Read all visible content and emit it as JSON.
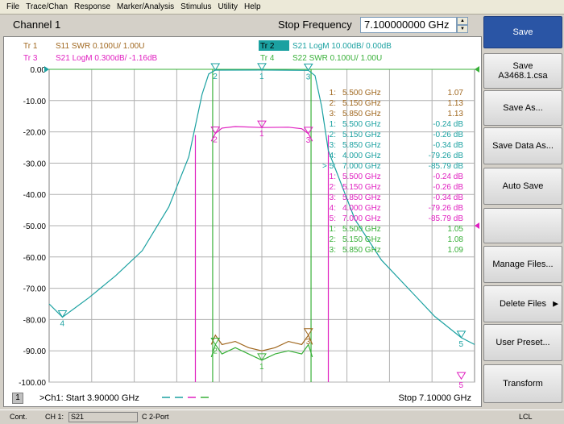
{
  "menu": [
    "File",
    "Trace/Chan",
    "Response",
    "Marker/Analysis",
    "Stimulus",
    "Utility",
    "Help"
  ],
  "header": {
    "channel_title": "Channel 1",
    "stop_label": "Stop Frequency",
    "stop_value": "7.100000000 GHz"
  },
  "traces": [
    {
      "id": "Tr 1",
      "text": "S11 SWR 0.100U/  1.00U",
      "color": "#a0671e",
      "highlight": false
    },
    {
      "id": "Tr 2",
      "text": "S21 LogM 10.00dB/  0.00dB",
      "color": "#1ba1a1",
      "highlight": true
    },
    {
      "id": "Tr 3",
      "text": "S21 LogM 0.300dB/  -1.16dB",
      "color": "#e020c0",
      "highlight": false
    },
    {
      "id": "Tr 4",
      "text": "S22 SWR 0.100U/  1.00U",
      "color": "#38b038",
      "highlight": false
    }
  ],
  "y_ticks": [
    "0.00",
    "-10.00",
    "-20.00",
    "-30.00",
    "-40.00",
    "-50.00",
    "-60.00",
    "-70.00",
    "-80.00",
    "-90.00",
    "-100.00"
  ],
  "marker_table": [
    {
      "marker": "1:",
      "freq": "5.500 GHz",
      "value": "1.07",
      "color": "#a0671e"
    },
    {
      "marker": "2:",
      "freq": "5.150 GHz",
      "value": "1.13",
      "color": "#a0671e"
    },
    {
      "marker": "3:",
      "freq": "5.850 GHz",
      "value": "1.13",
      "color": "#a0671e"
    },
    {
      "marker": "1:",
      "freq": "5.500 GHz",
      "value": "-0.24 dB",
      "color": "#1ba1a1"
    },
    {
      "marker": "2:",
      "freq": "5.150 GHz",
      "value": "-0.26 dB",
      "color": "#1ba1a1"
    },
    {
      "marker": "3:",
      "freq": "5.850 GHz",
      "value": "-0.34 dB",
      "color": "#1ba1a1"
    },
    {
      "marker": "4:",
      "freq": "4.000 GHz",
      "value": "-79.26 dB",
      "color": "#1ba1a1"
    },
    {
      "marker": "> 5:",
      "freq": "7.000 GHz",
      "value": "-85.79 dB",
      "color": "#1ba1a1"
    },
    {
      "marker": "1:",
      "freq": "5.500 GHz",
      "value": "-0.24 dB",
      "color": "#e020c0"
    },
    {
      "marker": "2:",
      "freq": "5.150 GHz",
      "value": "-0.26 dB",
      "color": "#e020c0"
    },
    {
      "marker": "3:",
      "freq": "5.850 GHz",
      "value": "-0.34 dB",
      "color": "#e020c0"
    },
    {
      "marker": "4:",
      "freq": "4.000 GHz",
      "value": "-79.26 dB",
      "color": "#e020c0"
    },
    {
      "marker": "5:",
      "freq": "7.000 GHz",
      "value": "-85.79 dB",
      "color": "#e020c0"
    },
    {
      "marker": "1:",
      "freq": "5.500 GHz",
      "value": "1.05",
      "color": "#38b038"
    },
    {
      "marker": "2:",
      "freq": "5.150 GHz",
      "value": "1.08",
      "color": "#38b038"
    },
    {
      "marker": "3:",
      "freq": "5.850 GHz",
      "value": "1.09",
      "color": "#38b038"
    }
  ],
  "footer": {
    "channel_num": "1",
    "start_text": ">Ch1: Start  3.90000 GHz",
    "stop_text": "Stop  7.10000 GHz"
  },
  "softkeys": [
    {
      "label": "Save",
      "sub": "",
      "active": true,
      "arrow": false
    },
    {
      "label": "Save",
      "sub": "A3468.1.csa",
      "active": false,
      "arrow": false
    },
    {
      "label": "Save As...",
      "sub": "",
      "active": false,
      "arrow": false
    },
    {
      "label": "Save Data As...",
      "sub": "",
      "active": false,
      "arrow": false
    },
    {
      "label": "Auto Save",
      "sub": "",
      "active": false,
      "arrow": false
    },
    {
      "label": "",
      "sub": "",
      "active": false,
      "arrow": false
    },
    {
      "label": "Manage Files...",
      "sub": "",
      "active": false,
      "arrow": false
    },
    {
      "label": "Delete Files",
      "sub": "",
      "active": false,
      "arrow": true
    },
    {
      "label": "User Preset...",
      "sub": "",
      "active": false,
      "arrow": false
    },
    {
      "label": "Transform",
      "sub": "",
      "active": false,
      "arrow": false
    }
  ],
  "status": {
    "mode": "Cont.",
    "channel": "CH 1:",
    "trace": "S21",
    "cal": "C  2-Port",
    "lcl": "LCL"
  },
  "chart_data": {
    "type": "line",
    "x_range": [
      3.9,
      7.1
    ],
    "x_unit": "GHz",
    "ylim": [
      -100,
      0
    ],
    "y_unit": "dB",
    "grid": true,
    "series": [
      {
        "name": "Tr 2 S21 LogM",
        "color": "#1ba1a1",
        "x": [
          3.9,
          4.0,
          4.2,
          4.4,
          4.6,
          4.8,
          4.95,
          5.05,
          5.1,
          5.15,
          5.5,
          5.85,
          5.9,
          5.95,
          6.0,
          6.2,
          6.4,
          6.6,
          6.8,
          7.0,
          7.1
        ],
        "y": [
          -75,
          -79.26,
          -73,
          -66,
          -58,
          -44,
          -28,
          -8,
          -1.5,
          -0.26,
          -0.24,
          -0.34,
          -2,
          -12,
          -26,
          -48,
          -61,
          -70,
          -79,
          -85.79,
          -88
        ]
      },
      {
        "name": "Tr 3 S21 LogM",
        "color": "#e020c0",
        "x": [
          5.12,
          5.15,
          5.2,
          5.3,
          5.5,
          5.7,
          5.8,
          5.85,
          5.88
        ],
        "y": [
          -23,
          -20.5,
          -18.8,
          -18.3,
          -18.6,
          -18.5,
          -19.0,
          -20.6,
          -23
        ]
      },
      {
        "name": "Tr 1 S11 SWR",
        "color": "#a0671e",
        "x": [
          5.12,
          5.15,
          5.2,
          5.3,
          5.4,
          5.5,
          5.6,
          5.7,
          5.8,
          5.85,
          5.88
        ],
        "y": [
          -88,
          -85,
          -88,
          -87,
          -89,
          -90,
          -89,
          -87,
          -88,
          -85,
          -88
        ]
      },
      {
        "name": "Tr 4 S22 SWR",
        "color": "#38b038",
        "x": [
          5.12,
          5.15,
          5.2,
          5.3,
          5.4,
          5.5,
          5.6,
          5.7,
          5.8,
          5.85,
          5.88
        ],
        "y": [
          -92,
          -88,
          -91,
          -89,
          -91,
          -93,
          -91,
          -90,
          -91,
          -88,
          -92
        ]
      }
    ]
  }
}
